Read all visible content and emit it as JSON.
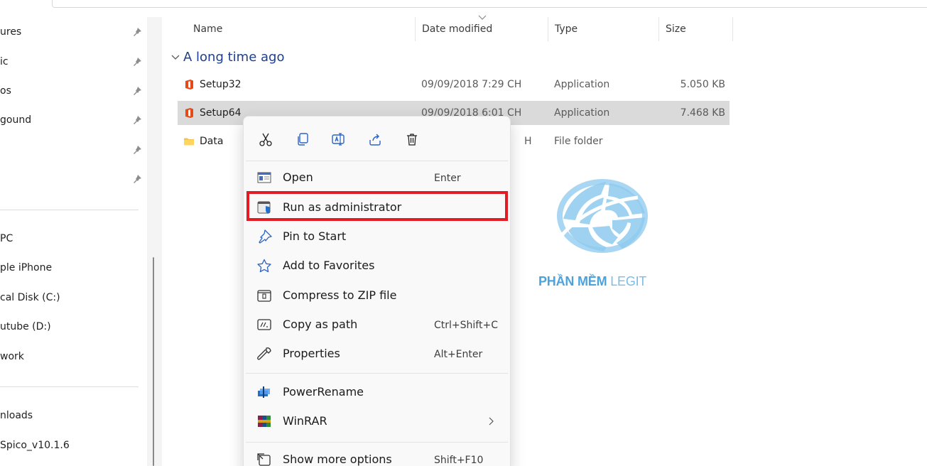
{
  "nav": {
    "pinned": [
      {
        "label": "ures"
      },
      {
        "label": "ic"
      },
      {
        "label": "os"
      },
      {
        "label": "gound"
      },
      {
        "label": ""
      },
      {
        "label": ""
      }
    ],
    "devices": [
      {
        "label": "PC"
      },
      {
        "label": "ple iPhone"
      },
      {
        "label": "cal Disk (C:)"
      },
      {
        "label": "utube (D:)"
      },
      {
        "label": "work"
      }
    ],
    "recent": [
      {
        "label": "nloads"
      },
      {
        "label": "Spico_v10.1.6"
      }
    ]
  },
  "columns": {
    "name": "Name",
    "date": "Date modified",
    "type": "Type",
    "size": "Size"
  },
  "group": {
    "label": "A long time ago"
  },
  "files": [
    {
      "name": "Setup32",
      "date": "09/09/2018 7:29 CH",
      "type": "Application",
      "size": "5.050 KB",
      "icon": "office-icon"
    },
    {
      "name": "Setup64",
      "date": "09/09/2018 6:01 CH",
      "type": "Application",
      "size": "7.468 KB",
      "icon": "office-icon"
    },
    {
      "name": "Data",
      "date": "H",
      "type": "File folder",
      "size": "",
      "icon": "folder-icon"
    }
  ],
  "watermark": {
    "part1": "PHẦN MỀM",
    "part2": "LEGIT"
  },
  "context_menu": {
    "quick_actions": [
      "cut-icon",
      "copy-icon",
      "rename-icon",
      "share-icon",
      "delete-icon"
    ],
    "items": [
      {
        "label": "Open",
        "shortcut": "Enter",
        "icon": "open-icon"
      },
      {
        "label": "Run as administrator",
        "shortcut": "",
        "icon": "shield-icon"
      },
      {
        "label": "Pin to Start",
        "shortcut": "",
        "icon": "pin-icon"
      },
      {
        "label": "Add to Favorites",
        "shortcut": "",
        "icon": "star-icon"
      },
      {
        "label": "Compress to ZIP file",
        "shortcut": "",
        "icon": "zip-icon"
      },
      {
        "label": "Copy as path",
        "shortcut": "Ctrl+Shift+C",
        "icon": "path-icon"
      },
      {
        "label": "Properties",
        "shortcut": "Alt+Enter",
        "icon": "wrench-icon"
      },
      {
        "label": "PowerRename",
        "shortcut": "",
        "icon": "powerrename-icon"
      },
      {
        "label": "WinRAR",
        "shortcut": "",
        "icon": "winrar-icon"
      },
      {
        "label": "Show more options",
        "shortcut": "Shift+F10",
        "icon": "more-options-icon"
      }
    ]
  },
  "colors": {
    "selection": "#dadada",
    "highlight_border": "#e21b24",
    "group_header": "#1e3f8f",
    "office_orange": "#e64a19",
    "folder_yellow": "#f4c24d",
    "accent_blue": "#1f6fd1"
  }
}
